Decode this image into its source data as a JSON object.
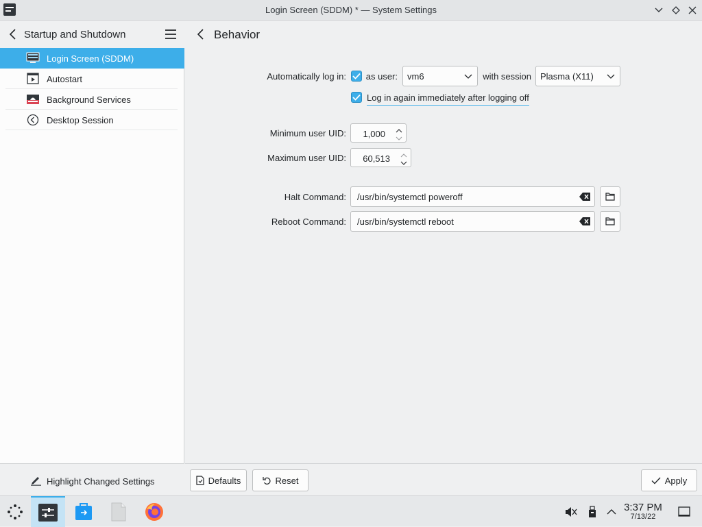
{
  "window": {
    "title": "Login Screen (SDDM) * — System Settings"
  },
  "sidebar": {
    "header_title": "Startup and Shutdown",
    "items": [
      {
        "label": "Login Screen (SDDM)",
        "icon": "monitor-icon",
        "selected": true
      },
      {
        "label": "Autostart",
        "icon": "autostart-icon",
        "selected": false
      },
      {
        "label": "Background Services",
        "icon": "services-icon",
        "selected": false
      },
      {
        "label": "Desktop Session",
        "icon": "session-icon",
        "selected": false
      }
    ],
    "footer_label": "Highlight Changed Settings"
  },
  "main": {
    "header_title": "Behavior",
    "autologin": {
      "label": "Automatically log in:",
      "checked": true,
      "as_user_label": "as user:",
      "user_value": "vm6",
      "with_session_label": "with session",
      "session_value": "Plasma (X11)",
      "relogin_label": "Log in again immediately after logging off",
      "relogin_checked": true
    },
    "min_uid": {
      "label": "Minimum user UID:",
      "value": "1,000"
    },
    "max_uid": {
      "label": "Maximum user UID:",
      "value": "60,513"
    },
    "halt": {
      "label": "Halt Command:",
      "value": "/usr/bin/systemctl poweroff"
    },
    "reboot": {
      "label": "Reboot Command:",
      "value": "/usr/bin/systemctl reboot"
    }
  },
  "buttons": {
    "defaults": "Defaults",
    "reset": "Reset",
    "apply": "Apply"
  },
  "taskbar": {
    "time": "3:37 PM",
    "date": "7/13/22",
    "apps": [
      "launcher-icon",
      "system-settings-icon",
      "discover-icon",
      "files-icon",
      "firefox-icon"
    ],
    "tray": [
      "muted-volume-icon",
      "usb-icon",
      "expand-tray-icon",
      "show-desktop-icon"
    ]
  },
  "colors": {
    "accent": "#3daee9",
    "window_bg": "#eff0f1",
    "panel_bg": "#fcfcfc"
  }
}
